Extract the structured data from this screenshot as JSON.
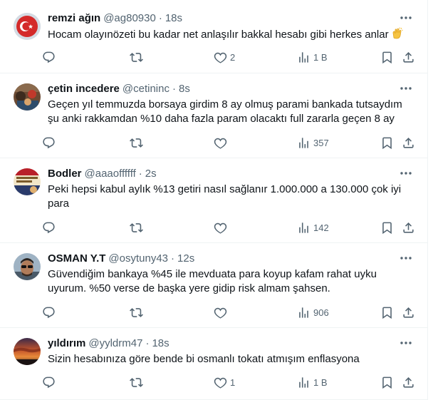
{
  "tweets": [
    {
      "name": "remzi ağın",
      "handle": "@ag80930",
      "time": "18s",
      "text": "Hocam olayınözeti bu kadar net anlaşılır bakkal hesabı gibi herkes anlar",
      "emoji": "clapping-hands",
      "replies": "",
      "retweets": "",
      "likes": "2",
      "views": "1 B",
      "avatar": "turkish-flag"
    },
    {
      "name": "çetin incedere",
      "handle": "@cetininc",
      "time": "8s",
      "text": "Geçen yıl temmuzda borsaya girdim 8 ay olmuş parami bankada tutsaydım şu anki rakkamdan %10 daha fazla param olacaktı full zararla geçen 8 ay",
      "replies": "",
      "retweets": "",
      "likes": "",
      "views": "357",
      "avatar": "photo-crowd"
    },
    {
      "name": "Bodler",
      "handle": "@aaaoffffff",
      "time": "2s",
      "text": "Peki hepsi kabul aylık %13 getiri nasıl sağlanır 1.000.000 a  130.000 çok iyi para",
      "replies": "",
      "retweets": "",
      "likes": "",
      "views": "142",
      "avatar": "poster"
    },
    {
      "name": "OSMAN Y.T",
      "handle": "@osytuny43",
      "time": "12s",
      "text": "Güvendiğim bankaya %45 ile mevduata para  koyup kafam rahat uyku uyurum. %50 verse de başka yere gidip risk almam şahsen.",
      "replies": "",
      "retweets": "",
      "likes": "",
      "views": "906",
      "avatar": "person-sunglasses"
    },
    {
      "name": "yıldırım",
      "handle": "@yyldrm47",
      "time": "18s",
      "text": "Sizin hesabınıza göre bende bi osmanlı tokatı atmışım enflasyona",
      "replies": "",
      "retweets": "",
      "likes": "1",
      "views": "1 B",
      "avatar": "sunset"
    }
  ],
  "separator": "·",
  "colors": {
    "text": "#0f1419",
    "secondary": "#536471",
    "border": "#eff3f4"
  }
}
